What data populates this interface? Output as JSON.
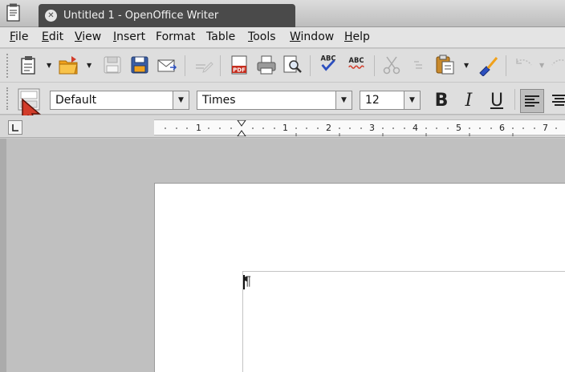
{
  "window": {
    "title": "Untitled 1 - OpenOffice Writer"
  },
  "menu": [
    {
      "key": "F",
      "rest": "ile"
    },
    {
      "key": "E",
      "rest": "dit"
    },
    {
      "key": "V",
      "rest": "iew"
    },
    {
      "key": "I",
      "rest": "nsert"
    },
    {
      "key": "F",
      "rest": "ormat",
      "underline_index": 0,
      "pre": "",
      "alt": "o"
    },
    {
      "key": "T",
      "rest": "able"
    },
    {
      "key": "T",
      "rest": "ools"
    },
    {
      "key": "W",
      "rest": "indow"
    },
    {
      "key": "H",
      "rest": "elp"
    }
  ],
  "formatting": {
    "paragraph_style": "Default",
    "font_name": "Times",
    "font_size": "12",
    "bold": "B",
    "italic": "I",
    "underline": "U"
  },
  "ruler": {
    "labels": [
      "1",
      "1",
      "2",
      "3",
      "4",
      "5",
      "6",
      "7"
    ]
  },
  "colors": {
    "accent_red": "#d23c2a",
    "pdf_red": "#c62e1f",
    "folder_orange": "#f0a11c",
    "spell_blue": "#2c4fbf"
  }
}
